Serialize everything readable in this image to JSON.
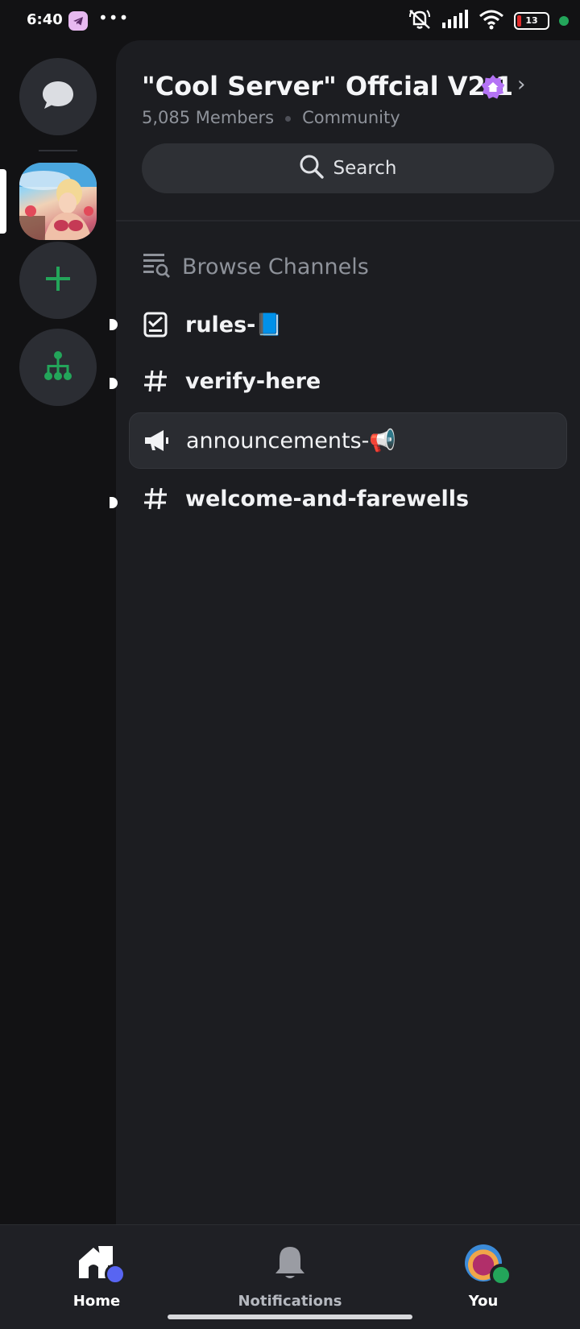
{
  "status_bar": {
    "time": "6:40",
    "more_dots": "•••",
    "battery_level": "13",
    "icons": [
      "telegram-icon",
      "bell-off-icon",
      "signal-icon",
      "wifi-icon",
      "battery-icon",
      "camera-in-use-dot"
    ]
  },
  "rail": {
    "items": [
      "direct-messages",
      "server",
      "add-server",
      "discover-hubs"
    ],
    "accent_color": "#23a55a"
  },
  "server": {
    "name": "\"Cool Server\" Offcial V2.1",
    "members": "5,085 Members",
    "type": "Community",
    "badge_color": "#b473f5"
  },
  "search": {
    "label": "Search"
  },
  "browse": {
    "label": "Browse Channels"
  },
  "channels": [
    {
      "name": "rules-📘",
      "icon": "rules-check-icon",
      "unread": true,
      "active": false
    },
    {
      "name": "verify-here",
      "icon": "hash-icon",
      "unread": true,
      "active": false
    },
    {
      "name": "announcements-📢",
      "icon": "megaphone-icon",
      "unread": false,
      "active": true
    },
    {
      "name": "welcome-and-farewells",
      "icon": "hash-icon",
      "unread": true,
      "active": false
    }
  ],
  "bottom_nav": {
    "home": "Home",
    "notifications": "Notifications",
    "you": "You",
    "selected": "Home"
  }
}
